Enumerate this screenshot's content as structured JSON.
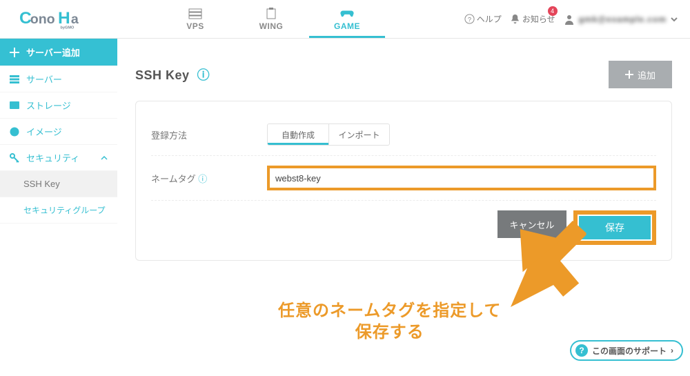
{
  "header": {
    "nav": [
      {
        "label": "VPS"
      },
      {
        "label": "WING"
      },
      {
        "label": "GAME"
      }
    ],
    "help": "ヘルプ",
    "notify": "お知らせ",
    "badge": "4",
    "user_masked": "gmk@example.com"
  },
  "sidebar": {
    "add_server": "サーバー追加",
    "items": [
      {
        "label": "サーバー"
      },
      {
        "label": "ストレージ"
      },
      {
        "label": "イメージ"
      },
      {
        "label": "セキュリティ"
      }
    ],
    "security_children": [
      {
        "label": "SSH Key"
      },
      {
        "label": "セキュリティグループ"
      }
    ]
  },
  "page": {
    "title": "SSH Key",
    "add_btn": "追加"
  },
  "form": {
    "reg_method_label": "登録方法",
    "tabs": {
      "auto": "自動作成",
      "import": "インポート"
    },
    "nametag_label": "ネームタグ",
    "nametag_value": "webst8-key",
    "cancel": "キャンセル",
    "save": "保存"
  },
  "annotation": {
    "line1": "任意のネームタグを指定して",
    "line2": "保存する"
  },
  "support": {
    "label": "この画面のサポート"
  }
}
